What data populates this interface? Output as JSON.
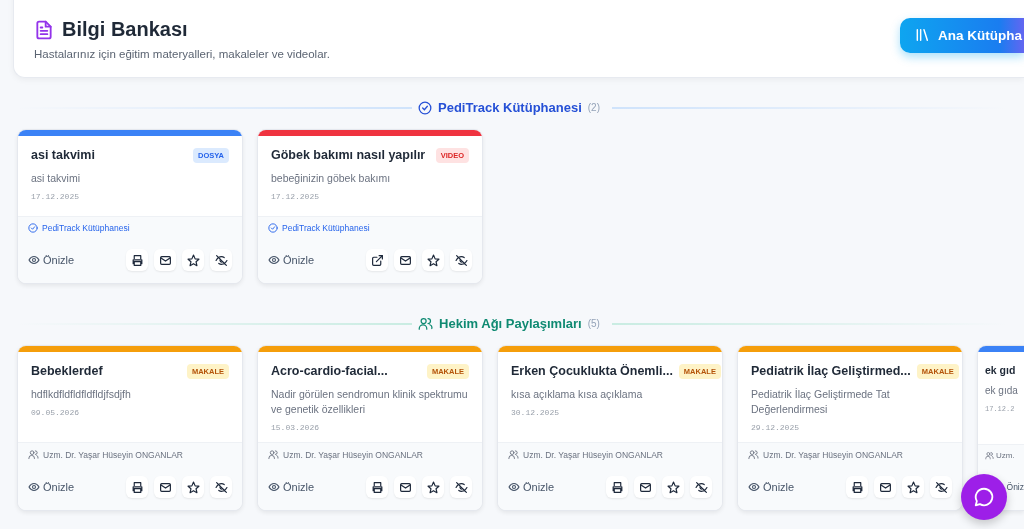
{
  "header": {
    "title": "Bilgi Bankası",
    "subtitle": "Hastalarınız için eğitim materyalleri, makaleler ve videolar.",
    "button": "Ana Kütüpha"
  },
  "sections": [
    {
      "kind": "library",
      "title": "PediTrack Kütüphanesi",
      "count": "(2)",
      "cards": [
        {
          "kind": "file",
          "title": "asi takvimi",
          "badge": "DOSYA",
          "description": "asi takvimi",
          "date": "17.12.2025",
          "source": "PediTrack Kütüphanesi",
          "preview": "Önizle",
          "actions": [
            {
              "kind": "print"
            },
            {
              "kind": "mail"
            },
            {
              "kind": "star"
            },
            {
              "kind": "hide"
            }
          ]
        },
        {
          "kind": "video",
          "title": "Göbek bakımı nasıl yapılır",
          "badge": "VIDEO",
          "description": "bebeğinizin göbek bakımı",
          "date": "17.12.2025",
          "source": "PediTrack Kütüphanesi",
          "preview": "Önizle",
          "actions": [
            {
              "kind": "external"
            },
            {
              "kind": "mail"
            },
            {
              "kind": "star"
            },
            {
              "kind": "hide"
            }
          ]
        }
      ]
    },
    {
      "kind": "network",
      "title": "Hekim Ağı Paylaşımları",
      "count": "(5)",
      "cards": [
        {
          "kind": "article",
          "title": "Bebeklerdef",
          "badge": "MAKALE",
          "description": "hdflkdfldfldfldfldjfsdjfh",
          "date": "09.05.2026",
          "source": "Uzm. Dr. Yaşar Hüseyin ONGANLAR",
          "preview": "Önizle",
          "actions": [
            {
              "kind": "print"
            },
            {
              "kind": "mail"
            },
            {
              "kind": "star"
            },
            {
              "kind": "hide"
            }
          ]
        },
        {
          "kind": "article",
          "title": "Acro-cardio-facial...",
          "badge": "MAKALE",
          "description": "Nadir görülen sendromun klinik spektrumu ve genetik özellikleri",
          "date": "15.03.2026",
          "source": "Uzm. Dr. Yaşar Hüseyin ONGANLAR",
          "preview": "Önizle",
          "actions": [
            {
              "kind": "print"
            },
            {
              "kind": "mail"
            },
            {
              "kind": "star"
            },
            {
              "kind": "hide"
            }
          ]
        },
        {
          "kind": "article",
          "title": "Erken Çocuklukta Önemli...",
          "badge": "MAKALE",
          "description": "kısa açıklama kısa açıklama",
          "date": "30.12.2025",
          "source": "Uzm. Dr. Yaşar Hüseyin ONGANLAR",
          "preview": "Önizle",
          "actions": [
            {
              "kind": "print"
            },
            {
              "kind": "mail"
            },
            {
              "kind": "star"
            },
            {
              "kind": "hide"
            }
          ]
        },
        {
          "kind": "article",
          "title": "Pediatrik İlaç Geliştirmed...",
          "badge": "MAKALE",
          "description": "Pediatrik İlaç Geliştirmede Tat Değerlendirmesi",
          "date": "29.12.2025",
          "source": "Uzm. Dr. Yaşar Hüseyin ONGANLAR",
          "preview": "Önizle",
          "actions": [
            {
              "kind": "print"
            },
            {
              "kind": "mail"
            },
            {
              "kind": "star"
            },
            {
              "kind": "hide"
            }
          ]
        },
        {
          "kind": "file",
          "title": "ek gıd",
          "description": "ek gıda",
          "date": "17.12.2",
          "source": "Uzm.",
          "preview": "Öniz"
        }
      ]
    }
  ]
}
